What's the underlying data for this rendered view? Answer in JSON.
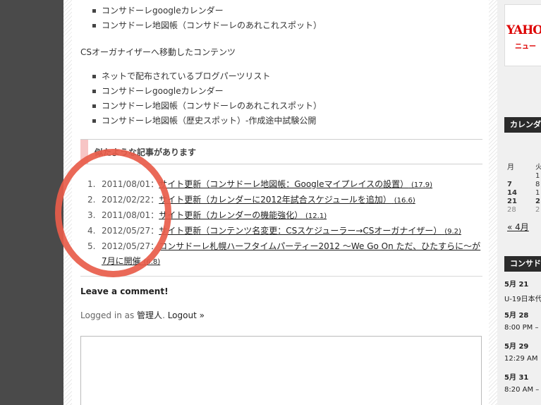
{
  "top_list": [
    "コンサドーレgoogleカレンダー",
    "コンサドーレ地図帳（コンサドーレのあれこれスポット）"
  ],
  "cs_section_label": "CSオーガナイザーへ移動したコンテンツ",
  "cs_list": [
    "ネットで配布されているブログパーツリスト",
    "コンサドーレgoogleカレンダー",
    "コンサドーレ地図帳（コンサドーレのあれこれスポット）",
    "コンサドーレ地図帳（歴史スポット）-作成途中試験公開"
  ],
  "related": {
    "heading": "似たような記事があります",
    "items": [
      {
        "num": "1.",
        "date": "2011/08/01",
        "sep": "：",
        "title": "サイト更新（コンサドーレ地図帳：Googleマイプレイスの設置）",
        "score": "(17.9)"
      },
      {
        "num": "2.",
        "date": "2012/02/22",
        "sep": "：",
        "title": "サイト更新（カレンダーに2012年試合スケジュールを追加）",
        "score": "(16.6)"
      },
      {
        "num": "3.",
        "date": "2011/08/01",
        "sep": "：",
        "title": "サイト更新（カレンダーの機能強化）",
        "score": "(12.1)"
      },
      {
        "num": "4.",
        "date": "2012/05/27",
        "sep": "：",
        "title": "サイト更新（コンテンツ名変更：CSスケジューラー→CSオーガナイザー）",
        "score": "(9.2)"
      },
      {
        "num": "5.",
        "date": "2012/05/27",
        "sep": "：",
        "title": "コンサドーレ札幌ハーフタイムパーティー2012 〜We Go On ただ、ひたすらに〜が7月に開催",
        "score": "(6.8)"
      }
    ]
  },
  "comments": {
    "leave_label": "Leave a comment!",
    "logged_prefix": "Logged in as ",
    "user": "管理人",
    "logged_dot": ". ",
    "logout": "Logout »",
    "textarea_value": ""
  },
  "sidebar": {
    "yahoo_logo": "YAHO",
    "yahoo_sub": "ニュー",
    "calendar_title": "カレンダ",
    "cal_header_mon": "月",
    "cal_header_tue": "火",
    "cal_rows": [
      {
        "mon": "",
        "tue": "1"
      },
      {
        "mon": "7",
        "tue": "8"
      },
      {
        "mon": "14",
        "tue": "1"
      },
      {
        "mon": "21",
        "tue": "2"
      },
      {
        "mon": "28",
        "tue": "2"
      }
    ],
    "prev_month": "« 4月",
    "schedule_title": "コンサド",
    "events": [
      {
        "date": "5月 21",
        "text": "U-19日本代"
      },
      {
        "date": "5月 28",
        "text": "8:00 PM –"
      },
      {
        "date": "5月 29",
        "text": "12:29 AM"
      },
      {
        "date": "5月 31",
        "text": "8:20 AM –"
      }
    ]
  },
  "colors": {
    "annotation_circle": "#e85c4a",
    "left_gutter": "#4a4a4a",
    "related_bar": "#f7c5c5"
  }
}
